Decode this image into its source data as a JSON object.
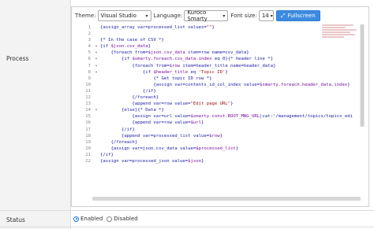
{
  "form": {
    "process_label": "Process",
    "status_label": "Status",
    "status_options": [
      {
        "label": "Enabled",
        "checked": true
      },
      {
        "label": "Disabled",
        "checked": false
      }
    ]
  },
  "toolbar": {
    "theme_label": "Theme:",
    "theme_value": "Visual Studio",
    "language_label": "Language:",
    "language_value": "Kuroco Smarty",
    "font_size_label": "Font size:",
    "font_size_value": "14",
    "fullscreen_label": "Fullscreen"
  },
  "editor": {
    "lines": [
      {
        "n": "1",
        "fold": "",
        "code": "{assign_array var=processed_list values=\"\"}"
      },
      {
        "n": "2",
        "fold": "",
        "code": ""
      },
      {
        "n": "3",
        "fold": "",
        "code": "{* In the case of CSV *}"
      },
      {
        "n": "4",
        "fold": "▾",
        "code": "{if $json.csv_data}"
      },
      {
        "n": "5",
        "fold": "▾",
        "code": "    {foreach from=$json.csv_data item=row name=csv_data}"
      },
      {
        "n": "6",
        "fold": "▾",
        "code": "        {if $smarty.foreach.csv_data.index eq 0}{* header line *}"
      },
      {
        "n": "7",
        "fold": "▾",
        "code": "            {foreach from=$row item=header_title name=header_data}"
      },
      {
        "n": "8",
        "fold": "▾",
        "code": "                {if $header_title eq 'Topic ID'}"
      },
      {
        "n": "9",
        "fold": "",
        "code": "                    {* Get topic ID row *}"
      },
      {
        "n": "10",
        "fold": "",
        "code": "                    {assign var=contents_id_col_index value=$smarty.foreach.header_data.index}"
      },
      {
        "n": "11",
        "fold": "",
        "code": "                {/if}"
      },
      {
        "n": "12",
        "fold": "",
        "code": "            {/foreach}"
      },
      {
        "n": "13",
        "fold": "",
        "code": "            {append var=row value=\"Edit page URL\"}"
      },
      {
        "n": "14",
        "fold": "▾",
        "code": "        {else}{* Data *}"
      },
      {
        "n": "15",
        "fold": "",
        "code": "            {assign var=url value=$smarty.const.ROOT_MNG_URL|cat:'/management/topics/topics_edi"
      },
      {
        "n": "16",
        "fold": "",
        "code": "            {append var=row value=$url}"
      },
      {
        "n": "17",
        "fold": "",
        "code": "        {/if}"
      },
      {
        "n": "18",
        "fold": "",
        "code": "        {append var=processed_list value=$row}"
      },
      {
        "n": "19",
        "fold": "",
        "code": "    {/foreach}"
      },
      {
        "n": "20",
        "fold": "",
        "code": "    {assign var=json.csv_data value=$processed_list}"
      },
      {
        "n": "21",
        "fold": "",
        "code": "{/if}"
      },
      {
        "n": "22",
        "fold": "",
        "code": "{assign var=processed_json value=$json}"
      }
    ]
  },
  "colors": {
    "accent": "#3d8be0",
    "code_blue": "#1a1aa6",
    "code_string": "#a31515"
  },
  "icons": {
    "fullscreen": "expand-icon",
    "select_chevron": "chevron-down-icon"
  }
}
